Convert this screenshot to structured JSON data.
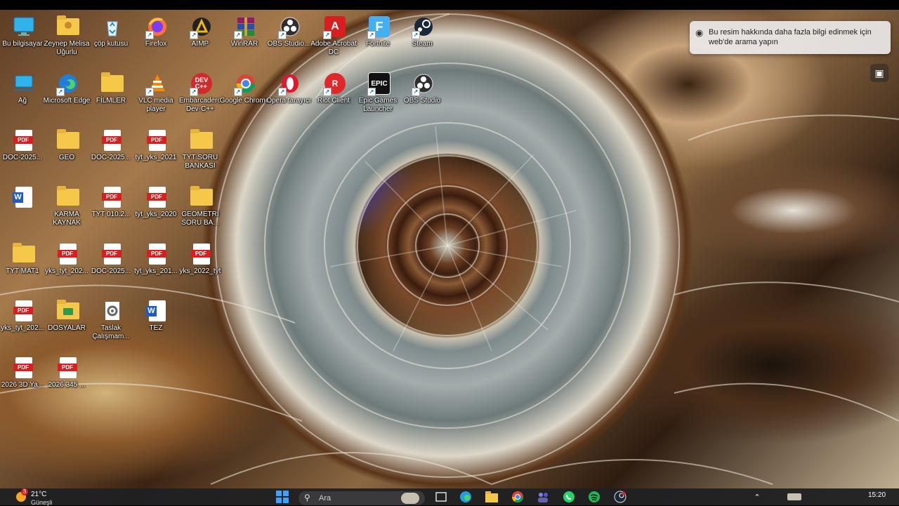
{
  "notification": {
    "text": "Bu resim hakkında daha fazla bilgi edinmek için web'de arama yapın",
    "icon": "camera-icon"
  },
  "icons": [
    {
      "name": "bu-bilgisayar",
      "label": "Bu bilgisayar",
      "type": "monitor",
      "shortcut": false
    },
    {
      "name": "zeynep-melisa-ugurlu",
      "label": "Zeynep Melisa Uğurlu",
      "type": "user-folder",
      "shortcut": false
    },
    {
      "name": "cop-kutusu",
      "label": "çöp kutusu",
      "type": "recycle",
      "shortcut": false
    },
    {
      "name": "firefox",
      "label": "Firefox",
      "type": "firefox",
      "shortcut": true
    },
    {
      "name": "aimp",
      "label": "AIMP",
      "type": "aimp",
      "shortcut": true
    },
    {
      "name": "winrar",
      "label": "WinRAR",
      "type": "winrar",
      "shortcut": true
    },
    {
      "name": "obs-studio-1",
      "label": "OBS Studio...",
      "type": "obs",
      "shortcut": true
    },
    {
      "name": "adobe-acrobat",
      "label": "Adobe Acrobat DC",
      "type": "acrobat",
      "shortcut": true
    },
    {
      "name": "fortnite",
      "label": "Fortnite",
      "type": "fortnite",
      "shortcut": true
    },
    {
      "name": "steam",
      "label": "Steam",
      "type": "steam",
      "shortcut": true
    },
    {
      "name": "ag",
      "label": "Ağ",
      "type": "network",
      "shortcut": false
    },
    {
      "name": "microsoft-edge",
      "label": "Microsoft Edge",
      "type": "edge",
      "shortcut": true
    },
    {
      "name": "filmler",
      "label": "FİLMLER",
      "type": "folder",
      "shortcut": false
    },
    {
      "name": "vlc",
      "label": "VLC media player",
      "type": "vlc",
      "shortcut": true
    },
    {
      "name": "embarcadero",
      "label": "Embarcadero Dev-C++",
      "type": "devcpp",
      "shortcut": true
    },
    {
      "name": "google-chrome",
      "label": "Google Chrome",
      "type": "chrome",
      "shortcut": true
    },
    {
      "name": "opera",
      "label": "Opera tarayıcı",
      "type": "opera",
      "shortcut": true
    },
    {
      "name": "riot-client",
      "label": "Riot Client",
      "type": "riot",
      "shortcut": true
    },
    {
      "name": "epic-games",
      "label": "Epic Games Launcher",
      "type": "epic",
      "shortcut": true
    },
    {
      "name": "obs-studio-2",
      "label": "OBS Studio",
      "type": "obs",
      "shortcut": true
    },
    {
      "name": "doc-2025-1",
      "label": "DOC-2025...",
      "type": "pdf",
      "shortcut": false
    },
    {
      "name": "geo",
      "label": "GEO",
      "type": "folder",
      "shortcut": false
    },
    {
      "name": "doc-2025-2",
      "label": "DOC-2025...",
      "type": "pdf",
      "shortcut": false
    },
    {
      "name": "tyt-yks-2021",
      "label": "tyt_yks_2021",
      "type": "pdf",
      "shortcut": false
    },
    {
      "name": "tyt-soru-bankasi",
      "label": "TYT SORU BANKASI",
      "type": "folder",
      "shortcut": false
    },
    {
      "name": "word-doc-1",
      "label": "",
      "type": "word",
      "shortcut": false
    },
    {
      "name": "karma-kaynak",
      "label": "KARMA KAYNAK",
      "type": "folder",
      "shortcut": false
    },
    {
      "name": "tyt-010",
      "label": "TYT 010.2...",
      "type": "pdf",
      "shortcut": false
    },
    {
      "name": "tyt-yks-2020",
      "label": "tyt_yks_2020",
      "type": "pdf",
      "shortcut": false
    },
    {
      "name": "geometri-soru",
      "label": "GEOMETRİ SORU BA...",
      "type": "folder",
      "shortcut": false
    },
    {
      "name": "tyt-mat1",
      "label": "TYT MAT1",
      "type": "folder",
      "shortcut": false
    },
    {
      "name": "yks-tyt-202-1",
      "label": "yks_tyt_202...",
      "type": "pdf",
      "shortcut": false
    },
    {
      "name": "doc-2025-3",
      "label": "DOC-2025...",
      "type": "pdf",
      "shortcut": false
    },
    {
      "name": "tyt-yks-201",
      "label": "tyt_yks_201...",
      "type": "pdf",
      "shortcut": false
    },
    {
      "name": "yks-2022-tyt",
      "label": "yks_2022_tyt",
      "type": "pdf",
      "shortcut": false
    },
    {
      "name": "yks-tyt-202-2",
      "label": "yks_tyt_202...",
      "type": "pdf",
      "shortcut": false
    },
    {
      "name": "dosyalar",
      "label": "DOSYALAR",
      "type": "folder-green",
      "shortcut": false
    },
    {
      "name": "taslak-calisma",
      "label": "Taslak Çalışmam...",
      "type": "settings",
      "shortcut": false
    },
    {
      "name": "tez",
      "label": "TEZ",
      "type": "word",
      "shortcut": false
    },
    {
      "name": "2026-3d",
      "label": "2026 3D Ya...",
      "type": "pdf",
      "shortcut": false
    },
    {
      "name": "2026-345",
      "label": "2026 345 ...",
      "type": "pdf",
      "shortcut": false
    }
  ],
  "taskbar": {
    "weather": {
      "temp": "21°C",
      "condition": "Güneşli",
      "badge": "3"
    },
    "search": {
      "placeholder": "Ara"
    },
    "clock": {
      "time": "15:20"
    },
    "apps": [
      "windows-start",
      "task-view",
      "edge",
      "file-explorer",
      "chrome",
      "teams",
      "whatsapp",
      "spotify",
      "steam"
    ]
  },
  "colors": {
    "taskbar": "#202022",
    "pdf_red": "#d81e1e",
    "folder_yellow": "#f6c84a",
    "word_blue": "#1e5bc6"
  }
}
